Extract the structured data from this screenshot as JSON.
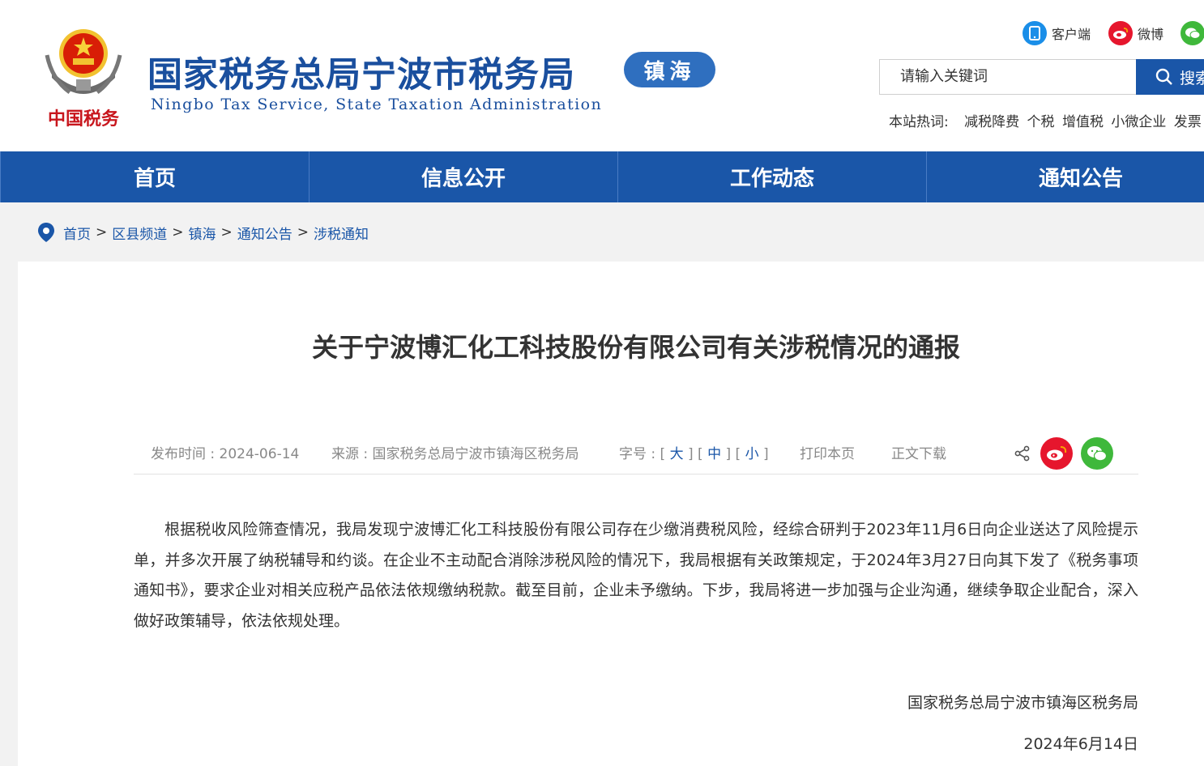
{
  "header": {
    "title": "国家税务总局宁波市税务局",
    "subtitle": "Ningbo Tax Service, State Taxation Administration",
    "region": "镇海",
    "emblem_text": "中国税务"
  },
  "social": {
    "client_label": "客户端",
    "weibo_label": "微博"
  },
  "search": {
    "placeholder": "请输入关键词",
    "button_label": "搜索"
  },
  "hot": {
    "label": "本站热词:",
    "words": [
      "减税降费",
      "个税",
      "增值税",
      "小微企业",
      "发票"
    ]
  },
  "nav": {
    "items": [
      "首页",
      "信息公开",
      "工作动态",
      "通知公告"
    ]
  },
  "breadcrumb": [
    "首页",
    "区县频道",
    "镇海",
    "通知公告",
    "涉税通知"
  ],
  "article": {
    "title": "关于宁波博汇化工科技股份有限公司有关涉税情况的通报",
    "date": "发布时间 : 2024-06-14",
    "source": "来源 : 国家税务总局宁波市镇海区税务局",
    "font_label": "字号 :",
    "font_large": "大",
    "font_medium": "中",
    "font_small": "小",
    "print": "打印本页",
    "download": "正文下载",
    "body": "根据税收风险筛查情况，我局发现宁波博汇化工科技股份有限公司存在少缴消费税风险，经综合研判于2023年11月6日向企业送达了风险提示单，并多次开展了纳税辅导和约谈。在企业不主动配合消除涉税风险的情况下，我局根据有关政策规定，于2024年3月27日向其下发了《税务事项通知书》，要求企业对相关应税产品依法依规缴纳税款。截至目前，企业未予缴纳。下步，我局将进一步加强与企业沟通，继续争取企业配合，深入做好政策辅导，依法依规处理。",
    "signature": "国家税务总局宁波市镇海区税务局",
    "sign_date": "2024年6月14日"
  },
  "colors": {
    "brand_blue": "#1a56a8",
    "title_blue": "#1a4f9e",
    "weibo_red": "#e6162d",
    "wechat_green": "#3fb83b"
  }
}
